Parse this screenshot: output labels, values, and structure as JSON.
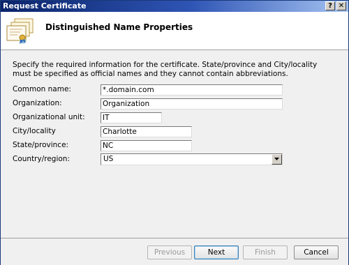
{
  "window": {
    "title": "Request Certificate",
    "help_button": "?",
    "close_button": "✕"
  },
  "header": {
    "heading": "Distinguished Name Properties",
    "icon": "certificate-stack-icon"
  },
  "description": "Specify the required information for the certificate. State/province and City/locality must be specified as official names and they cannot contain abbreviations.",
  "form": {
    "common_name": {
      "label": "Common name:",
      "value": "*.domain.com"
    },
    "organization": {
      "label": "Organization:",
      "value": "Organization"
    },
    "organizational_unit": {
      "label": "Organizational unit:",
      "value": "IT"
    },
    "city": {
      "label": "City/locality",
      "value": "Charlotte"
    },
    "state": {
      "label": "State/province:",
      "value": "NC"
    },
    "country": {
      "label": "Country/region:",
      "value": "US"
    }
  },
  "buttons": {
    "previous": "Previous",
    "next": "Next",
    "finish": "Finish",
    "cancel": "Cancel"
  },
  "colors": {
    "titlebar": "#0a246a",
    "dialog_bg": "#f0f0f0",
    "header_bg": "#ffffff"
  }
}
